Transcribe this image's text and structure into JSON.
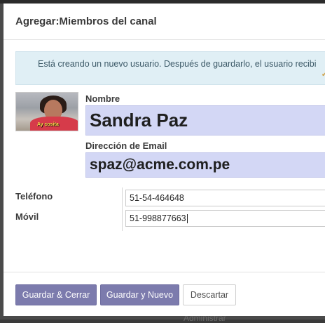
{
  "dialog": {
    "title": "Agregar:Miembros del canal"
  },
  "info_banner": {
    "text": "Está creando un nuevo usuario. Después de guardarlo, el usuario recibi",
    "tail": "✔"
  },
  "avatar": {
    "caption": "Ay cosita"
  },
  "form": {
    "name_label": "Nombre",
    "name_value": "Sandra Paz",
    "email_label": "Dirección de Email",
    "email_value": "spaz@acme.com.pe",
    "phone_label": "Teléfono",
    "phone_value": "51-54-464648",
    "mobile_label": "Móvil",
    "mobile_value": "51-998877663"
  },
  "footer": {
    "save_close_label": "Guardar & Cerrar",
    "save_new_label": "Guardar y Nuevo",
    "discard_label": "Descartar"
  },
  "backdrop": {
    "text": "Administrar"
  },
  "colors": {
    "primary_button": "#7c7bad",
    "required_field": "#d3d7f5",
    "info_banner": "#e0eff5"
  }
}
